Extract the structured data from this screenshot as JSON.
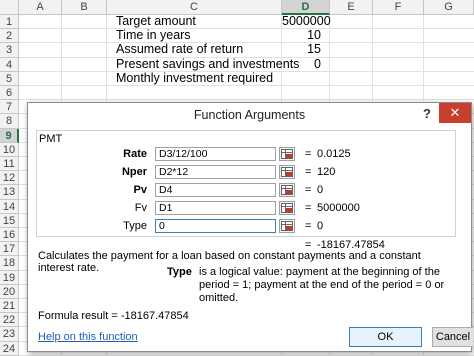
{
  "sheet": {
    "columns": [
      "A",
      "B",
      "C",
      "D",
      "E",
      "F",
      "G"
    ],
    "active_column": "D",
    "rows": [
      "1",
      "2",
      "3",
      "4",
      "5",
      "6",
      "7",
      "8",
      "9",
      "10",
      "11",
      "12",
      "13",
      "14",
      "15",
      "16",
      "17",
      "18",
      "19",
      "20",
      "21",
      "22",
      "23",
      "24"
    ],
    "active_row": "9",
    "cells": [
      {
        "label": "Target amount",
        "value": "5000000"
      },
      {
        "label": "Time in years",
        "value": "10"
      },
      {
        "label": "Assumed rate of return",
        "value": "15"
      },
      {
        "label": "Present savings and investments",
        "value": "0"
      },
      {
        "label": "Monthly investment required",
        "value": ""
      }
    ]
  },
  "dialog": {
    "title": "Function Arguments",
    "help_glyph": "?",
    "close_glyph": "✕",
    "function_name": "PMT",
    "args": [
      {
        "label": "Rate",
        "bold": true,
        "input": "D3/12/100",
        "result": "0.0125"
      },
      {
        "label": "Nper",
        "bold": true,
        "input": "D2*12",
        "result": "120"
      },
      {
        "label": "Pv",
        "bold": true,
        "input": "D4",
        "result": "0"
      },
      {
        "label": "Fv",
        "bold": false,
        "input": "D1",
        "result": "5000000"
      },
      {
        "label": "Type",
        "bold": false,
        "input": "0",
        "result": "0"
      }
    ],
    "equals": "=",
    "result": "-18167.47854",
    "description": "Calculates the payment for a loan based on constant payments and a constant interest rate.",
    "arg_desc_name": "Type",
    "arg_desc_text": "is a logical value: payment at the beginning of the period = 1; payment at the end of the period = 0 or omitted.",
    "formula_result_label": "Formula result =",
    "formula_result_value": "-18167.47854",
    "help_link": "Help on this function",
    "ok_label": "OK",
    "cancel_label": "Cancel"
  },
  "colors": {
    "accent_green": "#217346",
    "close_red": "#c7402e",
    "link_blue": "#1f5fb5"
  }
}
